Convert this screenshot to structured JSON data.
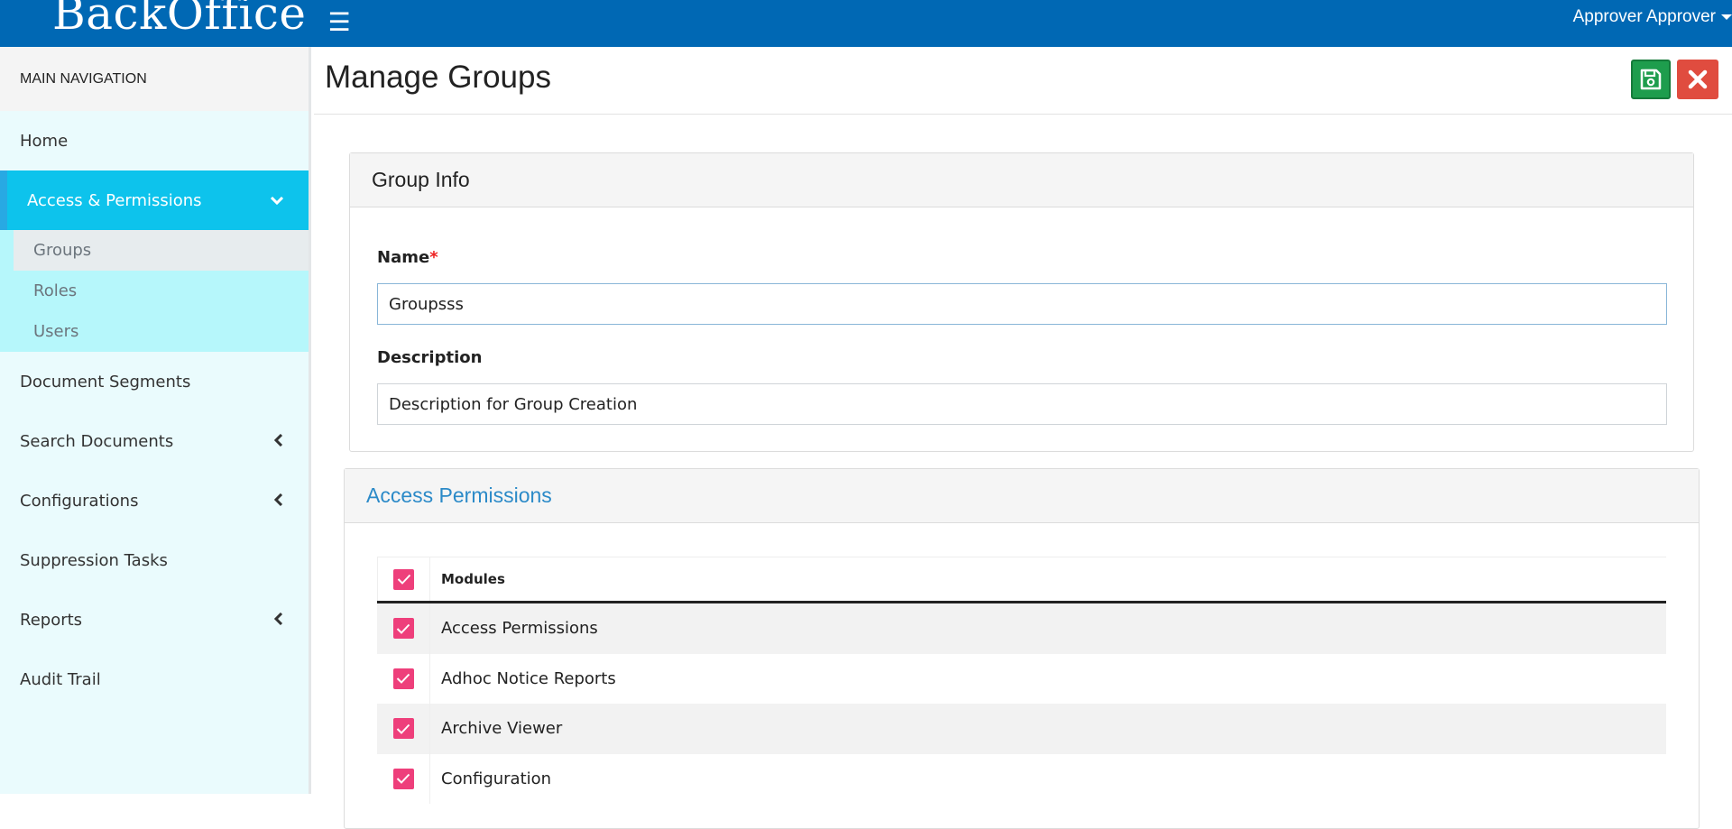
{
  "header": {
    "logo": "BackOffice",
    "user": "Approver Approver"
  },
  "sidebar": {
    "heading": "MAIN NAVIGATION",
    "items": {
      "home": "Home",
      "access": "Access & Permissions",
      "doc_segments": "Document Segments",
      "search_docs": "Search Documents",
      "configurations": "Configurations",
      "suppression": "Suppression Tasks",
      "reports": "Reports",
      "audit": "Audit Trail"
    },
    "sub_items": {
      "groups": "Groups",
      "roles": "Roles",
      "users": "Users"
    }
  },
  "main": {
    "title": "Manage Groups",
    "group_info": {
      "heading": "Group Info",
      "name_label": "Name",
      "required_mark": "*",
      "name_value": "Groupsss",
      "description_label": "Description",
      "description_value": "Description for Group Creation"
    },
    "access_permissions": {
      "heading": "Access Permissions",
      "column_header": "Modules",
      "rows": [
        "Access Permissions",
        "Adhoc Notice Reports",
        "Archive Viewer",
        "Configuration"
      ],
      "all_checked": true
    }
  },
  "colors": {
    "topbar": "#0068b4",
    "active_nav": "#0dc3ec",
    "checkbox": "#ee3f7b",
    "save_button": "#1e9d4d",
    "close_button": "#e04c3f",
    "section_heading": "#2b8ac8"
  },
  "icons": {
    "menu": "hamburger-icon",
    "user_caret": "caret-down-icon",
    "save": "floppy-disk-icon",
    "close": "x-icon",
    "expanded": "chevron-down-icon",
    "collapsed": "chevron-left-icon",
    "check": "check-icon"
  }
}
